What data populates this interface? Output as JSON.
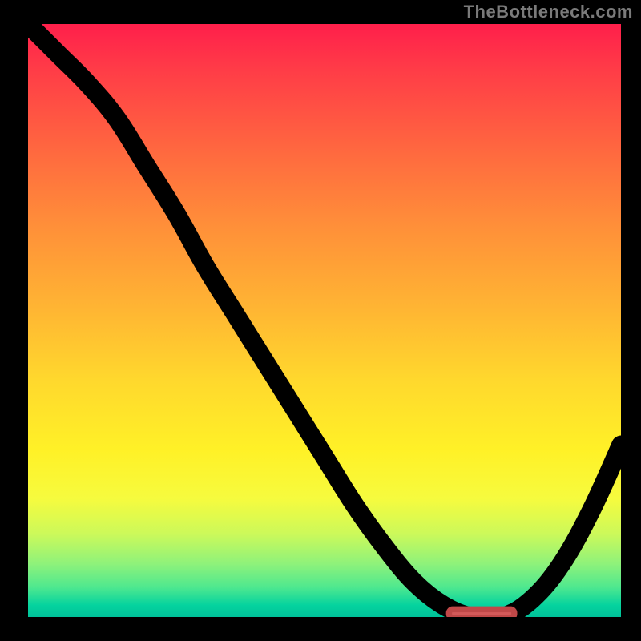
{
  "watermark": "TheBottleneck.com",
  "colors": {
    "background": "#000000",
    "curve": "#000000",
    "marker": "#d45a5a",
    "gradient_top": "#ff1f4b",
    "gradient_bottom": "#00c29a"
  },
  "chart_data": {
    "type": "line",
    "title": "",
    "xlabel": "",
    "ylabel": "",
    "xlim": [
      0,
      100
    ],
    "ylim": [
      0,
      100
    ],
    "series": [
      {
        "name": "bottleneck-curve",
        "x": [
          0,
          5,
          10,
          15,
          20,
          25,
          30,
          35,
          40,
          45,
          50,
          55,
          60,
          65,
          70,
          75,
          80,
          85,
          90,
          95,
          100
        ],
        "values": [
          100,
          95,
          90,
          84,
          76,
          68,
          59,
          51,
          43,
          35,
          27,
          19,
          12,
          6,
          2,
          0,
          0,
          3,
          9,
          18,
          29
        ]
      }
    ],
    "marker": {
      "x_start": 71,
      "x_end": 82,
      "y": 0.6
    }
  }
}
